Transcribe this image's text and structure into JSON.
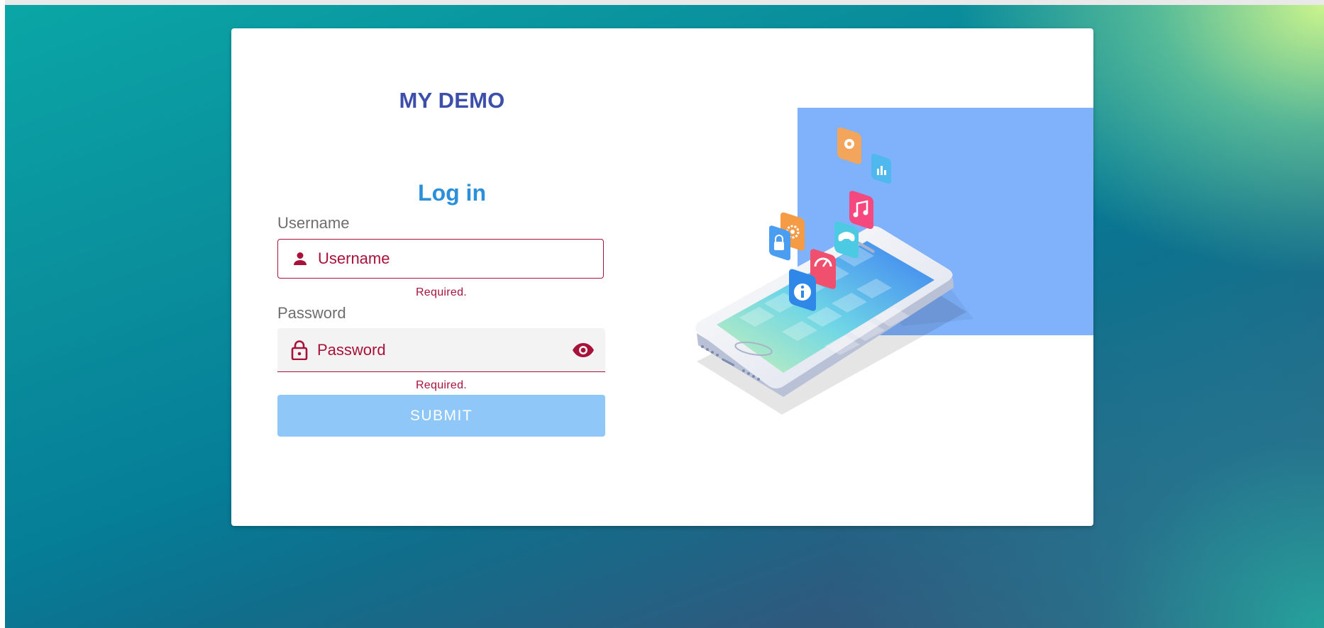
{
  "brand": "MY DEMO",
  "form": {
    "heading": "Log in",
    "username": {
      "label": "Username",
      "placeholder": "Username",
      "error": "Required.",
      "icon": "person-icon"
    },
    "password": {
      "label": "Password",
      "placeholder": "Password",
      "error": "Required.",
      "icon": "lock-icon",
      "toggle_icon": "eye-icon"
    },
    "submit_label": "SUBMIT"
  },
  "colors": {
    "brand": "#3d4faa",
    "heading": "#2c8fd9",
    "error": "#a8123a",
    "submit_bg": "#8ec7f8",
    "illustration_panel": "#7fb2fb"
  },
  "illustration": {
    "icons": [
      "camera-icon",
      "chart-icon",
      "music-icon",
      "settings-icon",
      "lock-icon",
      "gamepad-icon",
      "speedometer-icon",
      "info-icon"
    ]
  }
}
